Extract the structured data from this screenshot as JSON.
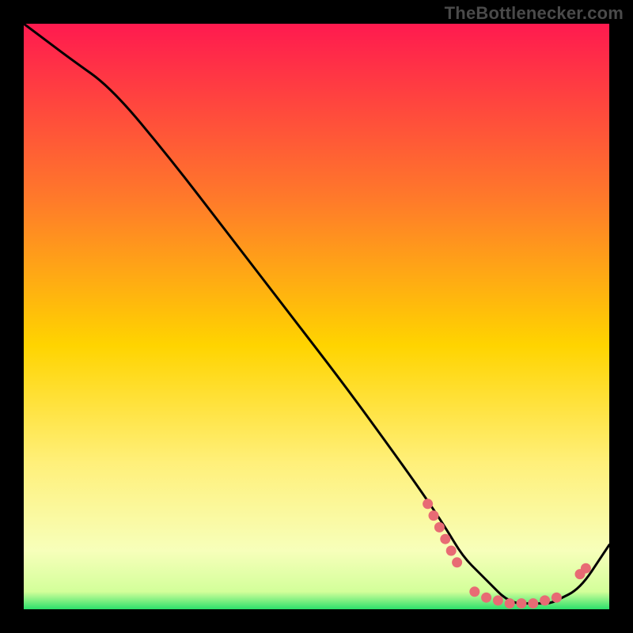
{
  "watermark": "TheBottlenecker.com",
  "colors": {
    "bg_black": "#000000",
    "grad_top": "#ff1a4f",
    "grad_mid_upper": "#ff7a2a",
    "grad_mid": "#ffd400",
    "grad_mid_lower": "#fff07a",
    "grad_lower": "#f7ffba",
    "grad_green": "#2be06a",
    "curve": "#000000",
    "marker": "#e86b74"
  },
  "chart_data": {
    "type": "line",
    "title": "",
    "xlabel": "",
    "ylabel": "",
    "xlim": [
      0,
      100
    ],
    "ylim": [
      0,
      100
    ],
    "series": [
      {
        "name": "bottleneck-curve",
        "x": [
          0,
          4,
          8,
          15,
          25,
          35,
          45,
          55,
          63,
          68,
          72,
          75,
          78,
          80,
          82,
          84,
          86,
          88,
          90,
          92,
          94,
          96,
          98,
          100
        ],
        "y": [
          100,
          97,
          94,
          89,
          77,
          64,
          51,
          38,
          27,
          20,
          14,
          9,
          6,
          4,
          2,
          1,
          1,
          1,
          1,
          2,
          3,
          5,
          8,
          11
        ]
      }
    ],
    "markers": [
      {
        "name": "cluster-left",
        "x": [
          69,
          70,
          71,
          72,
          73,
          74
        ],
        "y": [
          18,
          16,
          14,
          12,
          10,
          8
        ]
      },
      {
        "name": "cluster-bottom",
        "x": [
          77,
          79,
          81,
          83,
          85,
          87,
          89,
          91
        ],
        "y": [
          3,
          2,
          1.5,
          1,
          1,
          1,
          1.5,
          2
        ]
      },
      {
        "name": "cluster-right",
        "x": [
          95,
          96
        ],
        "y": [
          6,
          7
        ]
      }
    ]
  }
}
